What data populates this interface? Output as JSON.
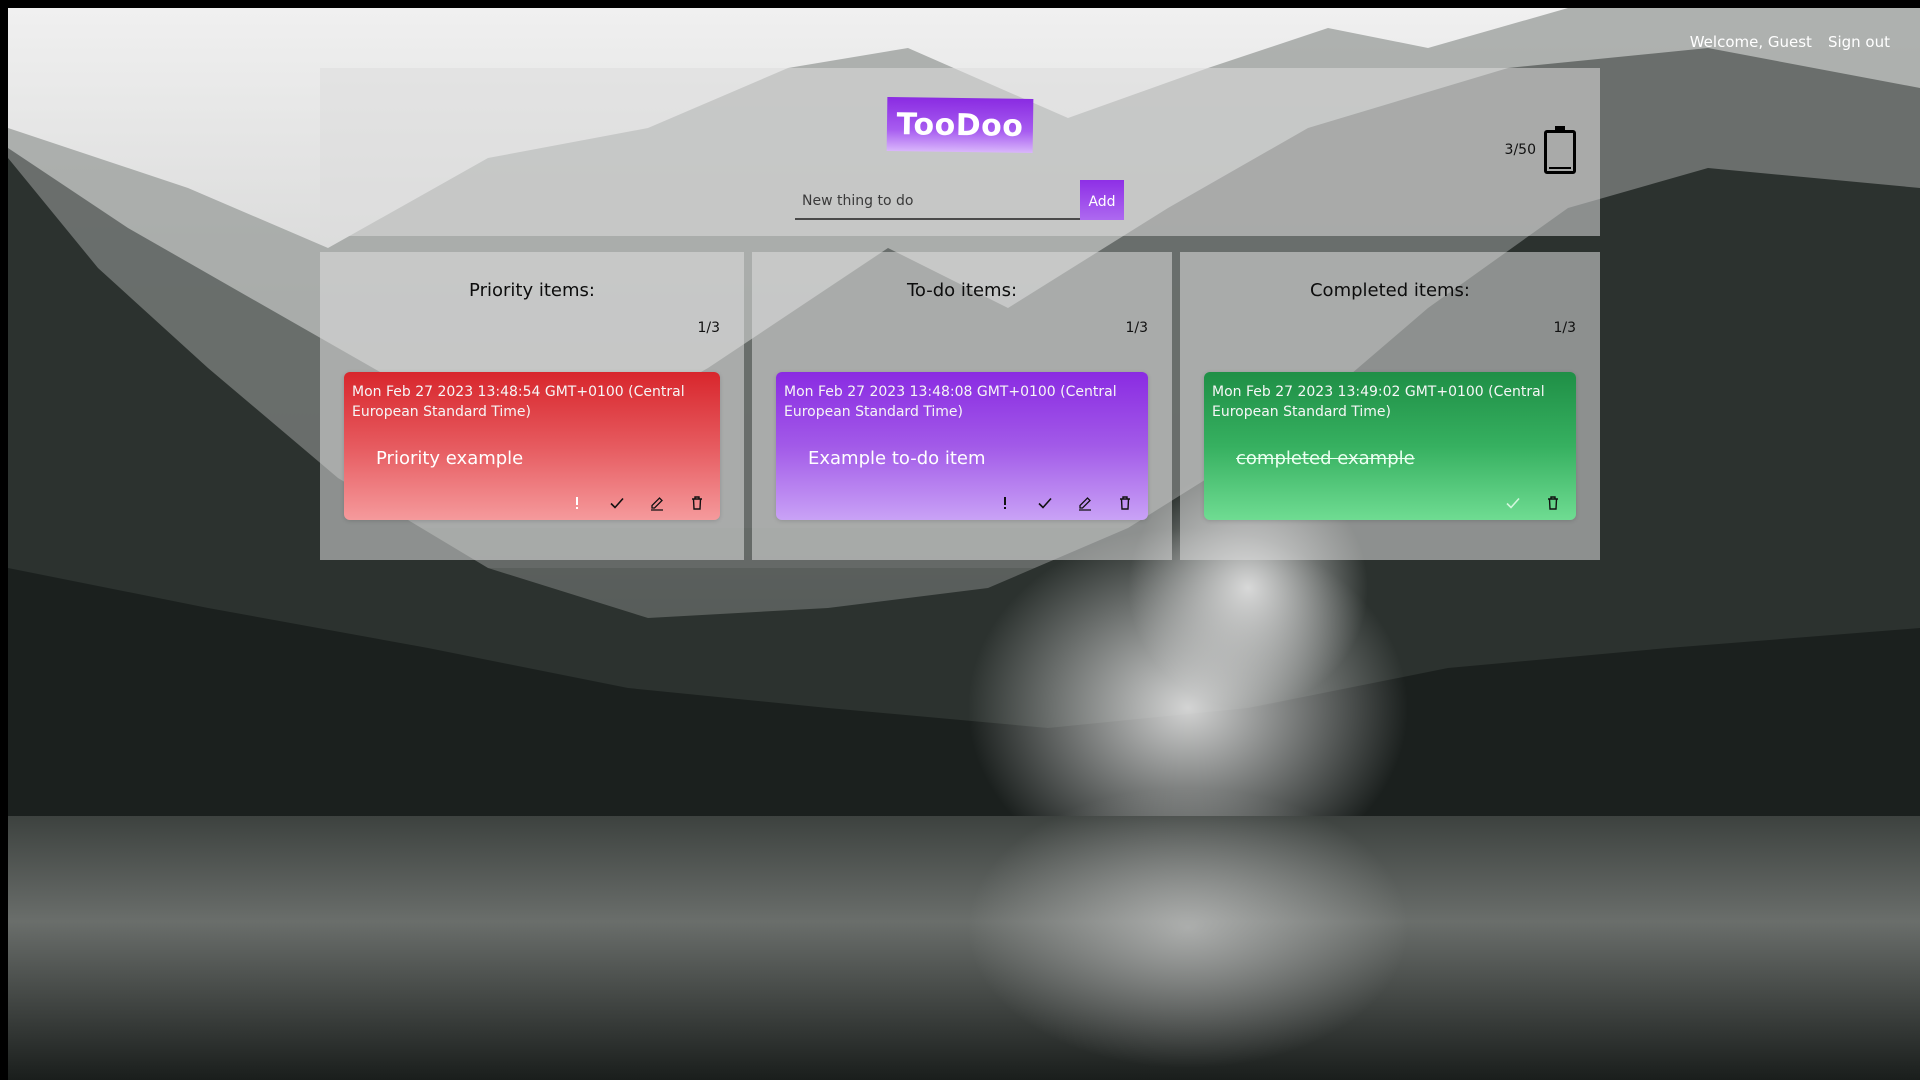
{
  "nav": {
    "welcome": "Welcome, Guest",
    "signout": "Sign out"
  },
  "header": {
    "logo": "TooDoo",
    "input_placeholder": "New thing to do",
    "add_label": "Add",
    "capacity_label": "3/50",
    "capacity_fraction": 0.06
  },
  "columns": [
    {
      "title": "Priority items:",
      "count": "1/3",
      "items": [
        {
          "date": "Mon Feb 27 2023 13:48:54 GMT+0100 (Central European Standard Time)",
          "text": "Priority example",
          "color": "#d8262c"
        }
      ]
    },
    {
      "title": "To-do items:",
      "count": "1/3",
      "items": [
        {
          "date": "Mon Feb 27 2023 13:48:08 GMT+0100 (Central European Standard Time)",
          "text": "Example to-do item",
          "color": "#8a2be2"
        }
      ]
    },
    {
      "title": "Completed items:",
      "count": "1/3",
      "items": [
        {
          "date": "Mon Feb 27 2023 13:49:02 GMT+0100 (Central European Standard Time)",
          "text": "completed example",
          "color": "#1f8f46"
        }
      ]
    }
  ],
  "icons": {
    "priority": "exclamation-icon",
    "complete": "check-icon",
    "edit": "pencil-icon",
    "delete": "trash-icon",
    "capacity": "battery-icon"
  }
}
